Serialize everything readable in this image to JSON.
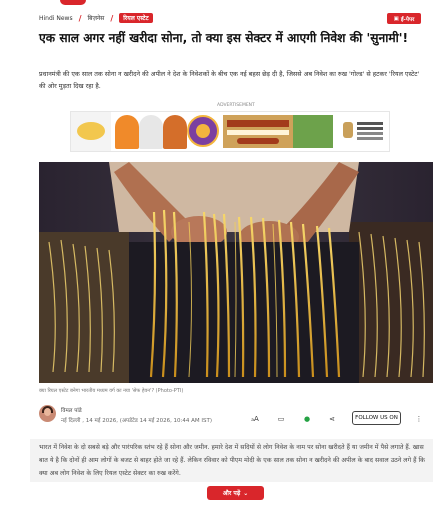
{
  "breadcrumb": {
    "items": [
      "Hindi News",
      "बिज़नेस"
    ],
    "active": "रियल एस्टेट"
  },
  "epaper": {
    "label": "ई-पेपर"
  },
  "article": {
    "headline": "एक साल अगर नहीं खरीदा सोना, तो क्या इस सेक्टर में आएगी निवेश की 'सुनामी'!",
    "summary": "प्रधानमंत्री की एक साल तक सोना न खरीदने की अपील ने देश के निवेशकों के बीच एक नई बहस छेड़ दी है, जिससे अब निवेश का रुख 'गोल्ड' से हटकर 'रियल एस्टेट' की ओर मुड़ता दिख रहा है.",
    "ad_label": "ADVERTISEMENT",
    "image_caption": "क्या रियल एस्टेट बनेगा भारतीय मध्यम वर्ग का नया 'सेफ हेवन'? (Photo-PTI)",
    "author": "विमल पांडे",
    "meta": "नई दिल्ली , 14 मई 2026, (अपडेटेड 14 मई 2026, 10:44 AM IST)",
    "follow_label": "FOLLOW US ON",
    "body": "भारत में निवेश के दो सबसे बड़े और पारंपरिक स्तंभ रहे हैं सोना और जमीन. हमारे देश में सदियों से लोग निवेश के नाम पर सोना खरीदते हैं या जमीन में पैसे लगाते हैं. खास बात ये है कि दोनों ही आम लोगों के बजट से बाहर होते जा रहे हैं. लेकिन रविवार को पीएम मोदी के एक साल तक सोना न खरीदने की अपील के बाद सवाल उठने लगे हैं कि क्या अब लोग निवेश के लिए रियल एस्टेट सेक्टर का रुख करेंगे.",
    "read_more": "और पढ़ें"
  },
  "colors": {
    "accent": "#d9262b"
  },
  "icons": [
    "font-size-icon",
    "comment-icon",
    "whatsapp-icon",
    "share-icon",
    "more-icon",
    "chevron-down-icon",
    "epaper-icon"
  ]
}
